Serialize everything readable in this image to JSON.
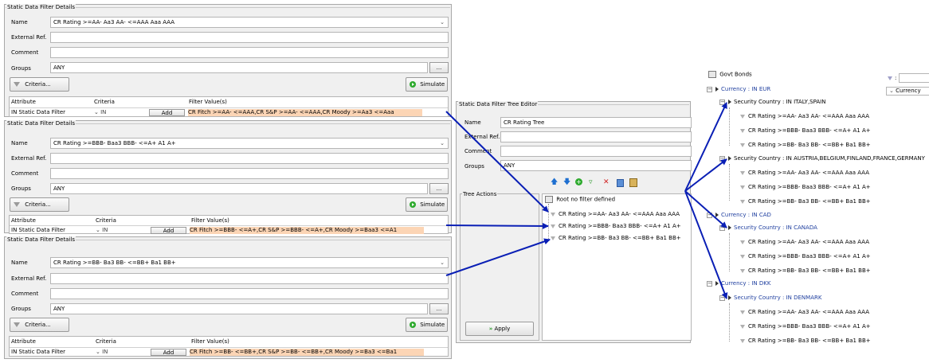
{
  "panels": [
    {
      "title": "Static Data Filter Details",
      "name_label": "Name",
      "name_value": "CR Rating >=AA- Aa3 AA- <=AAA Aaa AAA",
      "extref_label": "External Ref.",
      "comment_label": "Comment",
      "groups_label": "Groups",
      "groups_value": "ANY",
      "ellipsis": "...",
      "criteria_button": "Criteria...",
      "simulate_button": "Simulate",
      "headers": {
        "attribute": "Attribute",
        "criteria": "Criteria",
        "filter": "Filter Value(s)"
      },
      "row": {
        "attribute": "IN Static Data Filter",
        "criteria": "IN",
        "add": "Add",
        "filter": "CR Fitch >=AA- <=AAA,CR S&P >=AA- <=AAA,CR Moody >=Aa3 <=Aaa"
      }
    },
    {
      "title": "Static Data Filter Details",
      "name_label": "Name",
      "name_value": "CR Rating >=BBB- Baa3 BBB- <=A+ A1 A+",
      "extref_label": "External Ref.",
      "comment_label": "Comment",
      "groups_label": "Groups",
      "groups_value": "ANY",
      "ellipsis": "...",
      "criteria_button": "Criteria...",
      "simulate_button": "Simulate",
      "headers": {
        "attribute": "Attribute",
        "criteria": "Criteria",
        "filter": "Filter Value(s)"
      },
      "row": {
        "attribute": "IN Static Data Filter",
        "criteria": "IN",
        "add": "Add",
        "filter": "CR Fitch >=BBB- <=A+,CR S&P >=BBB- <=A+,CR Moody >=Baa3 <=A1"
      }
    },
    {
      "title": "Static Data Filter Details",
      "name_label": "Name",
      "name_value": "CR Rating >=BB- Ba3 BB- <=BB+ Ba1 BB+",
      "extref_label": "External Ref.",
      "comment_label": "Comment",
      "groups_label": "Groups",
      "groups_value": "ANY",
      "ellipsis": "...",
      "criteria_button": "Criteria...",
      "simulate_button": "Simulate",
      "headers": {
        "attribute": "Attribute",
        "criteria": "Criteria",
        "filter": "Filter Value(s)"
      },
      "row": {
        "attribute": "IN Static Data Filter",
        "criteria": "IN",
        "add": "Add",
        "filter": "CR Fitch >=BB- <=BB+,CR S&P >=BB- <=BB+,CR Moody >=Ba3 <=Ba1"
      }
    }
  ],
  "tree_editor": {
    "title": "Static Data Filter Tree Editor",
    "name_label": "Name",
    "name_value": "CR Rating Tree",
    "extref_label": "External Ref.",
    "comment_label": "Comment",
    "groups_label": "Groups",
    "groups_value": "ANY",
    "tree_actions_label": "Tree Actions",
    "apply_button": "Apply",
    "root_label": "Root no filter defined",
    "items": [
      "CR Rating >=AA- Aa3 AA- <=AAA Aaa AAA",
      "CR Rating >=BBB- Baa3 BBB- <=A+ A1 A+",
      "CR Rating >=BB- Ba3 BB- <=BB+ Ba1 BB+"
    ]
  },
  "result_tree": {
    "root": "Govt Bonds",
    "side_label": ":",
    "side_select": "Currency",
    "groups": [
      {
        "currency": "Currency : IN EUR",
        "countries": [
          {
            "label": "Security Country : IN ITALY,SPAIN",
            "ratings": [
              "CR Rating >=AA- Aa3 AA- <=AAA Aaa AAA",
              "CR Rating >=BBB- Baa3 BBB- <=A+ A1 A+",
              "CR Rating >=BB- Ba3 BB- <=BB+ Ba1 BB+"
            ]
          },
          {
            "label": "Security Country : IN AUSTRIA,BELGIUM,FINLAND,FRANCE,GERMANY",
            "ratings": [
              "CR Rating >=AA- Aa3 AA- <=AAA Aaa AAA",
              "CR Rating >=BBB- Baa3 BBB- <=A+ A1 A+",
              "CR Rating >=BB- Ba3 BB- <=BB+ Ba1 BB+"
            ]
          }
        ]
      },
      {
        "currency": "Currency : IN CAD",
        "countries": [
          {
            "label": "Security Country : IN CANADA",
            "ratings": [
              "CR Rating >=AA- Aa3 AA- <=AAA Aaa AAA",
              "CR Rating >=BBB- Baa3 BBB- <=A+ A1 A+",
              "CR Rating >=BB- Ba3 BB- <=BB+ Ba1 BB+"
            ]
          }
        ]
      },
      {
        "currency": "Currency : IN DKK",
        "countries": [
          {
            "label": "Security Country : IN DENMARK",
            "ratings": [
              "CR Rating >=AA- Aa3 AA- <=AAA Aaa AAA",
              "CR Rating >=BBB- Baa3 BBB- <=A+ A1 A+",
              "CR Rating >=BB- Ba3 BB- <=BB+ Ba1 BB+"
            ]
          }
        ]
      }
    ]
  },
  "colors": {
    "arrow": "#0a1fb5",
    "highlight": "#fcd5b5",
    "currency_text": "#1f3f9f"
  },
  "icons": [
    "funnel-icon",
    "simulate-icon",
    "chevron-down-icon",
    "up-arrow-icon",
    "down-arrow-icon",
    "add-icon",
    "edit-filter-icon",
    "delete-icon",
    "copy-icon",
    "paste-icon",
    "apply-icon",
    "tree-root-icon",
    "expander-icon"
  ]
}
